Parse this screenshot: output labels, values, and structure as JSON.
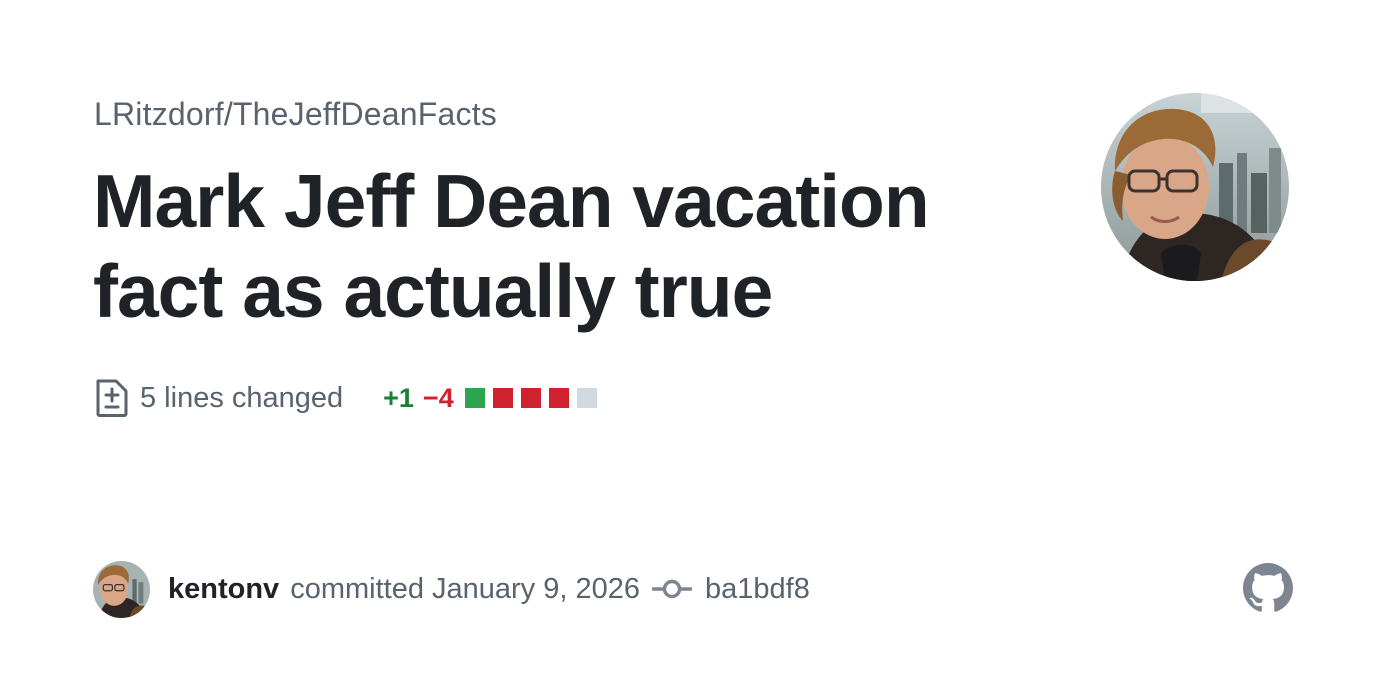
{
  "repo": {
    "full_name": "LRitzdorf/TheJeffDeanFacts"
  },
  "commit": {
    "title": "Mark Jeff Dean vacation fact as actually true",
    "lines_changed": "5 lines changed",
    "additions": "+1",
    "deletions": "−4",
    "diffstat_blocks": [
      "addition",
      "deletion",
      "deletion",
      "deletion",
      "neutral"
    ],
    "author": "kentonv",
    "committed_text": "committed January 9, 2026",
    "sha": "ba1bdf8"
  },
  "icons": {
    "diff": "file-diff-icon",
    "commit": "git-commit-icon",
    "brand": "github-mark-icon",
    "owner_avatar": "owner-avatar",
    "author_avatar": "author-avatar"
  },
  "colors": {
    "text_primary": "#1f2328",
    "text_muted": "#59636e",
    "addition": "#1a7f37",
    "deletion": "#cf222e",
    "block_addition": "#2da44e",
    "block_deletion": "#cf222e",
    "block_neutral": "#d1d9e0",
    "icon_gray": "#7d8590"
  }
}
